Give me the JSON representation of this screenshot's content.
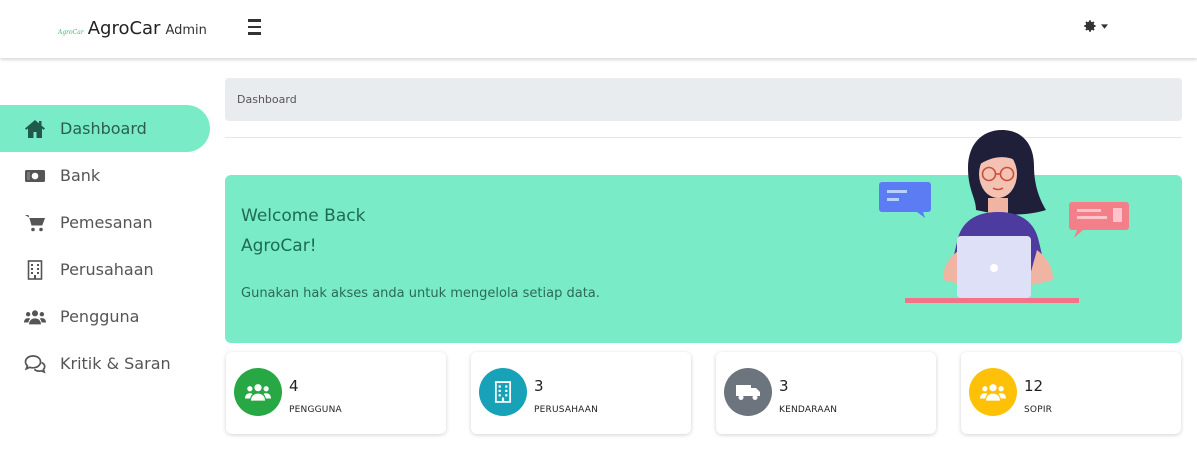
{
  "header": {
    "logo_text": "AgroCar",
    "brand_name": "AgroCar",
    "brand_sub": "Admin",
    "menu_icon": "hamburger-icon",
    "settings_icon": "gear-icon"
  },
  "sidebar": {
    "items": [
      {
        "label": "Dashboard",
        "icon": "home-icon",
        "active": true
      },
      {
        "label": "Bank",
        "icon": "money-icon",
        "active": false
      },
      {
        "label": "Pemesanan",
        "icon": "cart-icon",
        "active": false
      },
      {
        "label": "Perusahaan",
        "icon": "building-icon",
        "active": false
      },
      {
        "label": "Pengguna",
        "icon": "users-icon",
        "active": false
      },
      {
        "label": "Kritik & Saran",
        "icon": "comments-icon",
        "active": false
      }
    ]
  },
  "breadcrumb": {
    "label": "Dashboard"
  },
  "welcome": {
    "line1": "Welcome Back",
    "line2": "AgroCar!",
    "text": "Gunakan hak akses anda untuk mengelola setiap data."
  },
  "stats": [
    {
      "value": "4",
      "label": "PENGGUNA",
      "icon": "users-icon",
      "color": "#28a745"
    },
    {
      "value": "3",
      "label": "PERUSAHAAN",
      "icon": "building-icon",
      "color": "#17a2b8"
    },
    {
      "value": "3",
      "label": "KENDARAAN",
      "icon": "truck-icon",
      "color": "#6c757d"
    },
    {
      "value": "12",
      "label": "SOPIR",
      "icon": "users-icon",
      "color": "#ffc107"
    }
  ],
  "colors": {
    "accent": "#7aebc7",
    "breadcrumb_bg": "#e9ecef"
  }
}
